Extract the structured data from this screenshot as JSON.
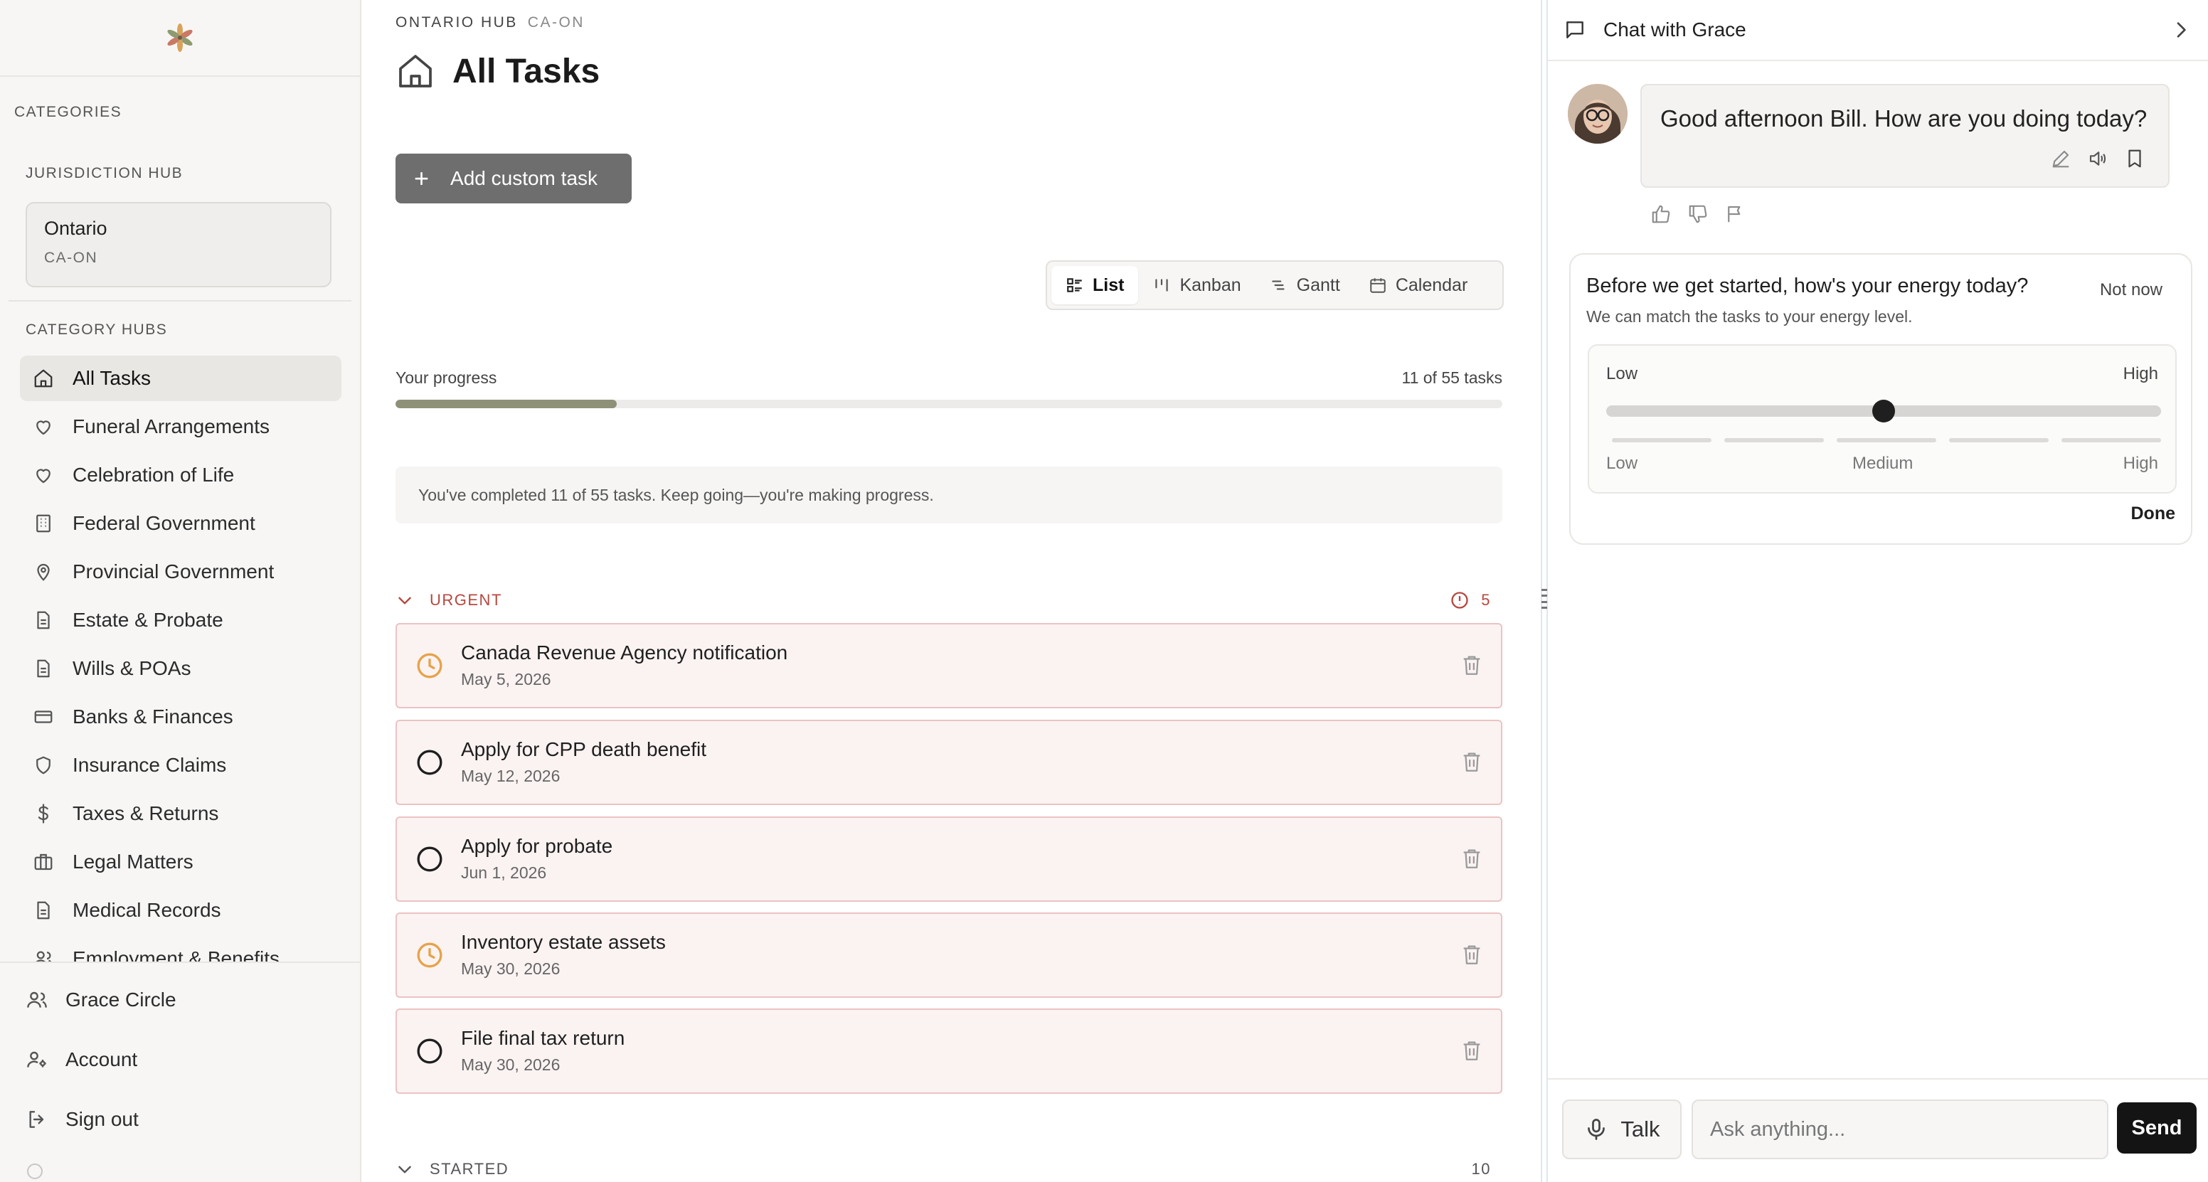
{
  "sidebar": {
    "categories_label": "CATEGORIES",
    "jurisdiction_label": "JURISDICTION HUB",
    "jurisdiction": {
      "name": "Ontario",
      "code": "CA-ON"
    },
    "category_hubs_label": "CATEGORY HUBS",
    "items": [
      {
        "label": "All Tasks",
        "icon": "home-icon",
        "active": true
      },
      {
        "label": "Funeral Arrangements",
        "icon": "heart-icon"
      },
      {
        "label": "Celebration of Life",
        "icon": "heart-icon"
      },
      {
        "label": "Federal Government",
        "icon": "building-icon"
      },
      {
        "label": "Provincial Government",
        "icon": "map-pin-icon"
      },
      {
        "label": "Estate & Probate",
        "icon": "document-icon"
      },
      {
        "label": "Wills & POAs",
        "icon": "document-icon"
      },
      {
        "label": "Banks & Finances",
        "icon": "credit-card-icon"
      },
      {
        "label": "Insurance Claims",
        "icon": "shield-icon"
      },
      {
        "label": "Taxes & Returns",
        "icon": "dollar-icon"
      },
      {
        "label": "Legal Matters",
        "icon": "briefcase-icon"
      },
      {
        "label": "Medical Records",
        "icon": "document-icon"
      },
      {
        "label": "Employment & Benefits",
        "icon": "users-icon"
      }
    ],
    "bottom": {
      "circle": "Grace Circle",
      "account": "Account",
      "sign_out": "Sign out"
    }
  },
  "main": {
    "crumb": {
      "hub": "ONTARIO HUB",
      "code": "CA-ON"
    },
    "title": "All Tasks",
    "add_button": "Add custom task",
    "views": [
      {
        "label": "List",
        "icon": "list-icon",
        "active": true
      },
      {
        "label": "Kanban",
        "icon": "kanban-icon"
      },
      {
        "label": "Gantt",
        "icon": "gantt-icon"
      },
      {
        "label": "Calendar",
        "icon": "calendar-icon"
      }
    ],
    "progress": {
      "label": "Your progress",
      "count_text": "11 of 55 tasks",
      "completed": 11,
      "total": 55,
      "fill_color": "#8e9178"
    },
    "note": "You've completed 11 of 55 tasks. Keep going—you're making progress.",
    "groups": {
      "urgent": {
        "label": "URGENT",
        "count": "5",
        "color": "#b5483f"
      },
      "started": {
        "label": "STARTED",
        "count": "10"
      }
    },
    "tasks": [
      {
        "name": "Canada Revenue Agency notification",
        "date": "May 5, 2026",
        "status": "in-progress"
      },
      {
        "name": "Apply for CPP death benefit",
        "date": "May 12, 2026",
        "status": "todo"
      },
      {
        "name": "Apply for probate",
        "date": "Jun 1, 2026",
        "status": "todo"
      },
      {
        "name": "Inventory estate assets",
        "date": "May 30, 2026",
        "status": "in-progress"
      },
      {
        "name": "File final tax return",
        "date": "May 30, 2026",
        "status": "todo"
      }
    ]
  },
  "chat": {
    "title": "Chat with Grace",
    "message": "Good afternoon Bill. How are you doing today?",
    "energy": {
      "question": "Before we get started, how's your energy today?",
      "subtitle": "We can match the tasks to your energy level.",
      "not_now": "Not now",
      "low_top": "Low",
      "high_top": "High",
      "level_labels": [
        "Low",
        "Medium",
        "High"
      ],
      "value": 0.5,
      "done": "Done"
    },
    "talk": "Talk",
    "input_placeholder": "Ask anything...",
    "send": "Send"
  }
}
